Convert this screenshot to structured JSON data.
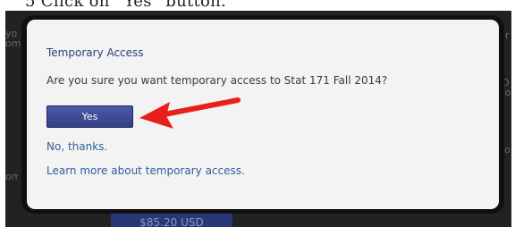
{
  "caption": "5   Click on “Yes” button.",
  "background": {
    "left_fragment": "yo\nom",
    "right_fragment_1": "ur",
    "right_fragment_2": "t\nID\nyo",
    "right_fragment_3": "co",
    "left_fragment_2": "om",
    "price_button": "$85.20 USD"
  },
  "modal": {
    "title": "Temporary Access",
    "question": "Are you sure you want temporary access to Stat 171 Fall 2014?",
    "yes_label": "Yes",
    "no_link": "No, thanks.",
    "learn_link": "Learn more about temporary access."
  },
  "annotation": {
    "arrow_color": "#e8201c",
    "arrow_icon": "red-arrow-pointing-left"
  },
  "colors": {
    "title": "#2c3f7b",
    "button": "#3b4790",
    "link": "#2f5e9e"
  }
}
